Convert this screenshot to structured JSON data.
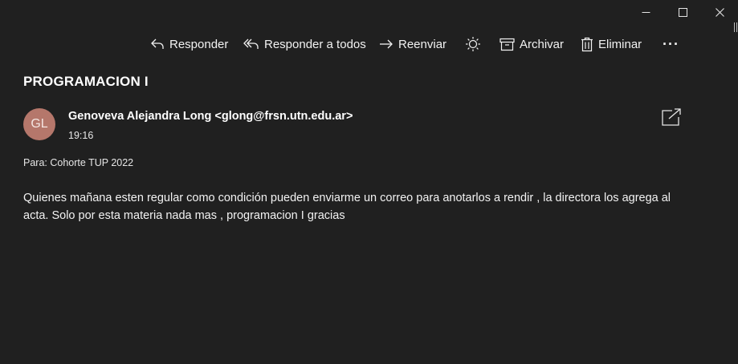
{
  "window": {
    "controls": {
      "minimize_icon": "minimize-icon",
      "maximize_icon": "maximize-icon",
      "close_icon": "close-icon"
    }
  },
  "toolbar": {
    "reply_label": "Responder",
    "reply_all_label": "Responder a todos",
    "forward_label": "Reenviar",
    "archive_label": "Archivar",
    "delete_label": "Eliminar",
    "more_label": "···"
  },
  "message": {
    "subject": "PROGRAMACION I",
    "avatar_initials": "GL",
    "avatar_color": "#b5776b",
    "sender": "Genoveva Alejandra Long <glong@frsn.utn.edu.ar>",
    "time": "19:16",
    "to": "Para: Cohorte TUP 2022",
    "body": "Quienes mañana esten regular como condición pueden enviarme un correo para anotarlos a rendir , la directora los agrega al acta. Solo por esta materia nada mas , programacion I gracias"
  },
  "colors": {
    "background": "#202020",
    "text": "#ffffff"
  }
}
